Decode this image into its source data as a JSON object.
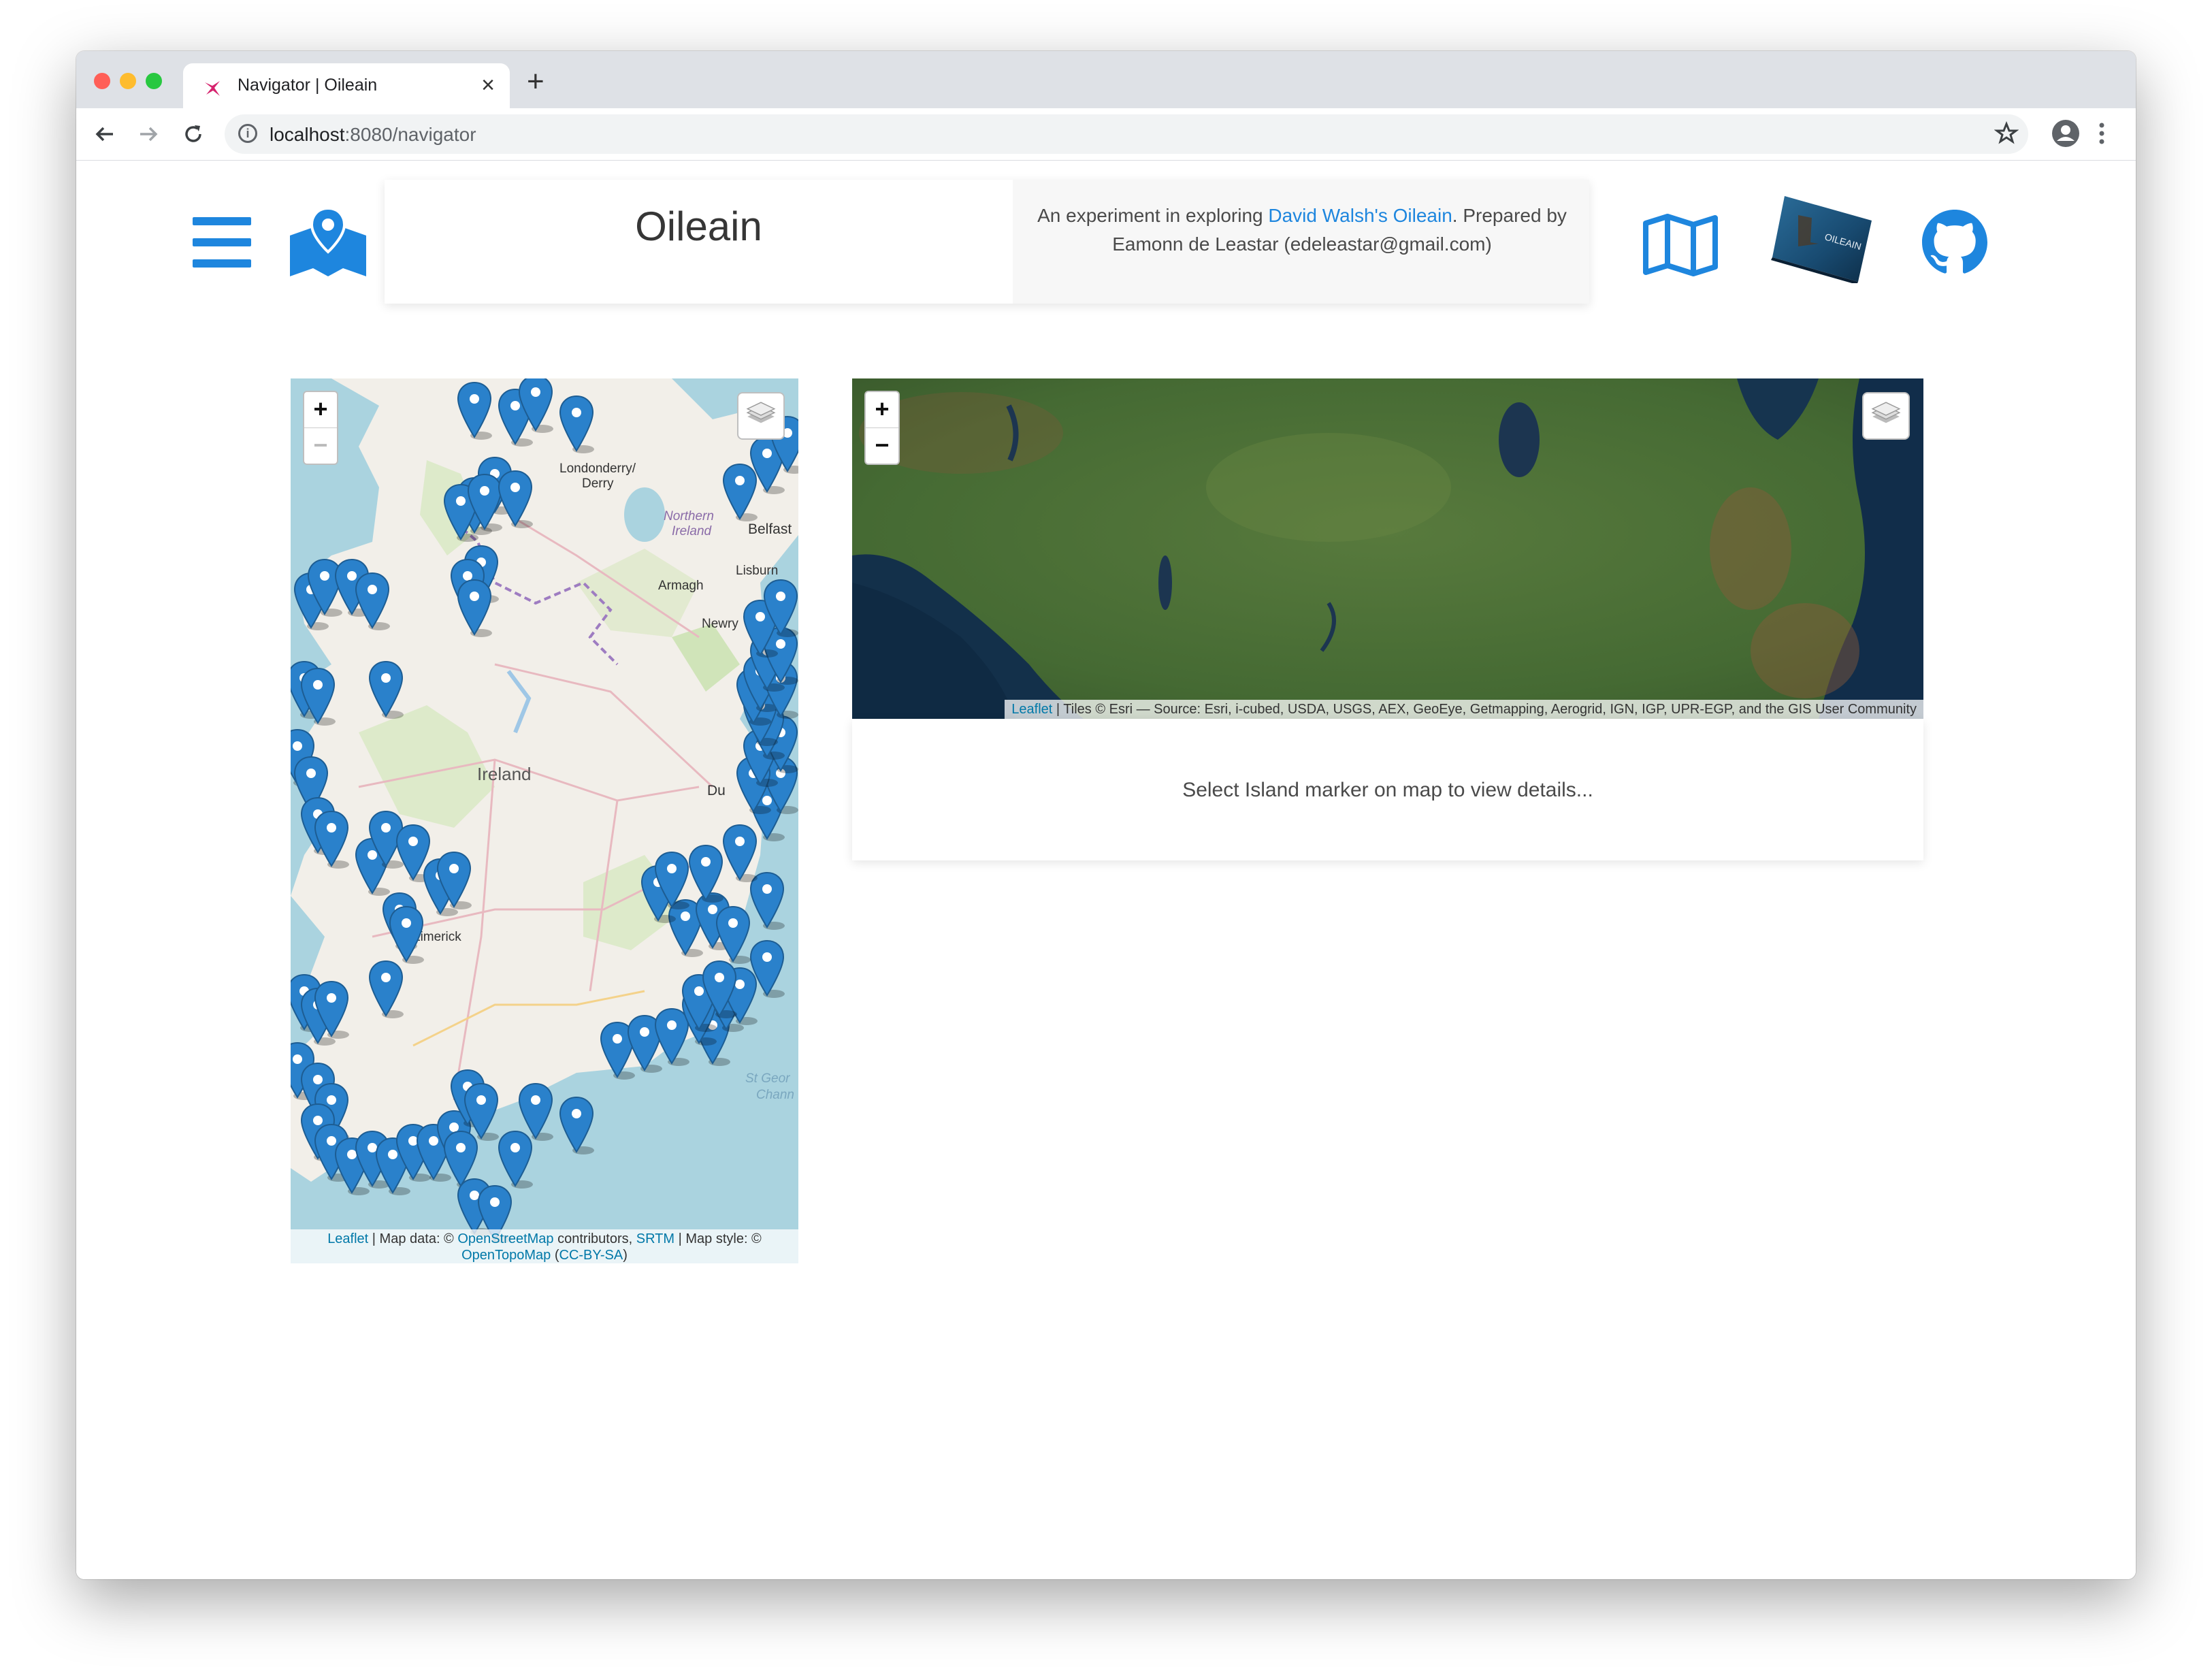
{
  "browser": {
    "tab_title": "Navigator | Oileain",
    "tab_close": "×",
    "new_tab": "+",
    "url_host": "localhost",
    "url_rest": ":8080/navigator"
  },
  "header": {
    "title": "Oileain",
    "description_prefix": "An experiment in exploring ",
    "description_link": "David Walsh's Oileain",
    "description_suffix": ". Prepared by Eamonn de Leastar (edeleastar@gmail.com)",
    "book_cover_title": "OILEAIN"
  },
  "left_map": {
    "zoom_in": "+",
    "zoom_out": "−",
    "labels": {
      "derry": "Londonderry/\nDerry",
      "ni": "Northern\nIreland",
      "belfast": "Belfast",
      "lisburn": "Lisburn",
      "armagh": "Armagh",
      "newry": "Newry",
      "ireland": "Ireland",
      "dublin": "Du",
      "limerick": "Limerick",
      "stgeorge": "St Geor\nChann"
    },
    "attribution": {
      "leaflet": "Leaflet",
      "t1": " | Map data: © ",
      "osm": "OpenStreetMap",
      "t2": " contributors, ",
      "srtm": "SRTM",
      "t3": " | Map style: © ",
      "otm": "OpenTopoMap",
      "t4": " (",
      "ccbysa": "CC-BY-SA",
      "t5": ")"
    }
  },
  "right_map": {
    "zoom_in": "+",
    "zoom_out": "−",
    "attribution": {
      "leaflet": "Leaflet",
      "text": " | Tiles © Esri — Source: Esri, i-cubed, USDA, USGS, AEX, GeoEye, Getmapping, Aerogrid, IGN, IGP, UPR-EGP, and the GIS User Community"
    }
  },
  "details": {
    "placeholder": "Select Island marker on map to view details..."
  },
  "colors": {
    "accent": "#1e86de",
    "marker": "#2a81cb",
    "sea": "#aad3df",
    "land": "#f2efe9"
  }
}
